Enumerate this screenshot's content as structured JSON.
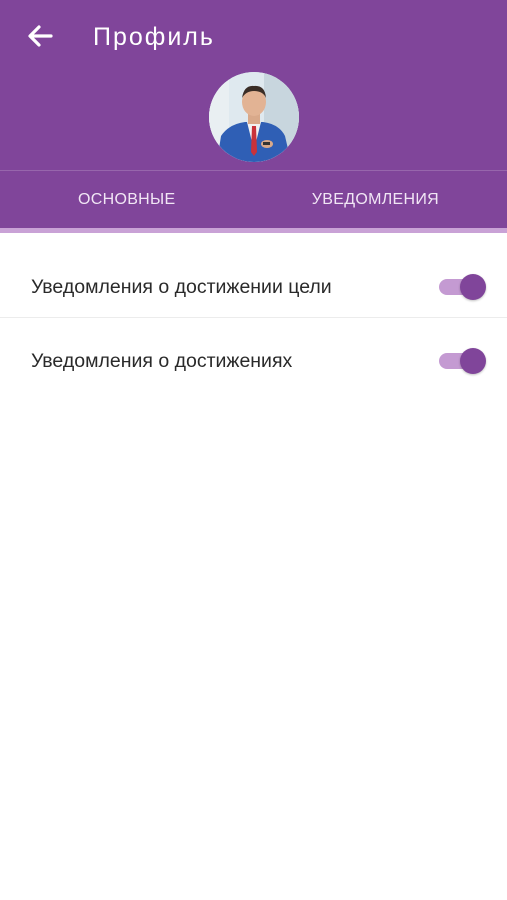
{
  "header": {
    "title": "Профиль",
    "back_icon": "arrow-left-icon",
    "background_color": "#80459a"
  },
  "avatar": {
    "description": "profile-photo"
  },
  "tabs": [
    {
      "label": "ОСНОВНЫЕ",
      "active": false
    },
    {
      "label": "УВЕДОМЛЕНИЯ",
      "active": true
    }
  ],
  "settings": [
    {
      "label": "Уведомления о достижении цели",
      "enabled": true
    },
    {
      "label": "Уведомления о достижениях",
      "enabled": true
    }
  ],
  "colors": {
    "accent": "#80459a",
    "toggle_track": "#c49ad2",
    "tab_indicator": "#c9a2d6"
  }
}
